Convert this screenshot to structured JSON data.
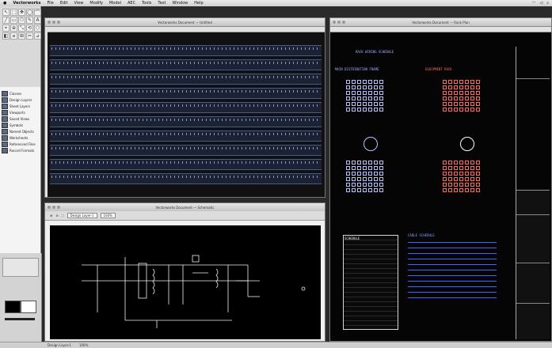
{
  "menubar": {
    "app": "Vectorworks",
    "items": [
      "File",
      "Edit",
      "View",
      "Modify",
      "Model",
      "AEC",
      "Tools",
      "Text",
      "Window",
      "Help"
    ]
  },
  "tools": [
    "↖",
    "⬚",
    "✥",
    "◯",
    "⌒",
    "╱",
    "▭",
    "⬠",
    "✎",
    "A",
    "⌖",
    "⊕",
    "⤡",
    "⟲",
    "⬡",
    "◧",
    "⌀",
    "⊞",
    "✂",
    "⊿"
  ],
  "navigation": {
    "items": [
      "Classes",
      "Design Layers",
      "Sheet Layers",
      "Viewports",
      "Saved Views",
      "Symbols",
      "Named Objects",
      "Worksheets",
      "Referenced Files",
      "Record Formats"
    ]
  },
  "windows": {
    "top_left_title": "Vectorworks Document — Untitled",
    "bottom_left_title": "Vectorworks Document — Schematic",
    "right_title": "Vectorworks Document — Rack Plan"
  },
  "rack_sheet": {
    "title": "RACK WIRING SCHEDULE",
    "left_heading": "MAIN DISTRIBUTION FRAME",
    "right_heading": "EQUIPMENT RACK",
    "table_heading": "SCHEDULE",
    "list_heading": "CABLE SCHEDULE"
  },
  "colors": {
    "accent_blue": "#b8c2ff",
    "accent_red": "#ff6a5c",
    "schematic_line": "#f2f2f2"
  },
  "status": {
    "zoom": "100%",
    "layer": "Design Layer-1"
  }
}
